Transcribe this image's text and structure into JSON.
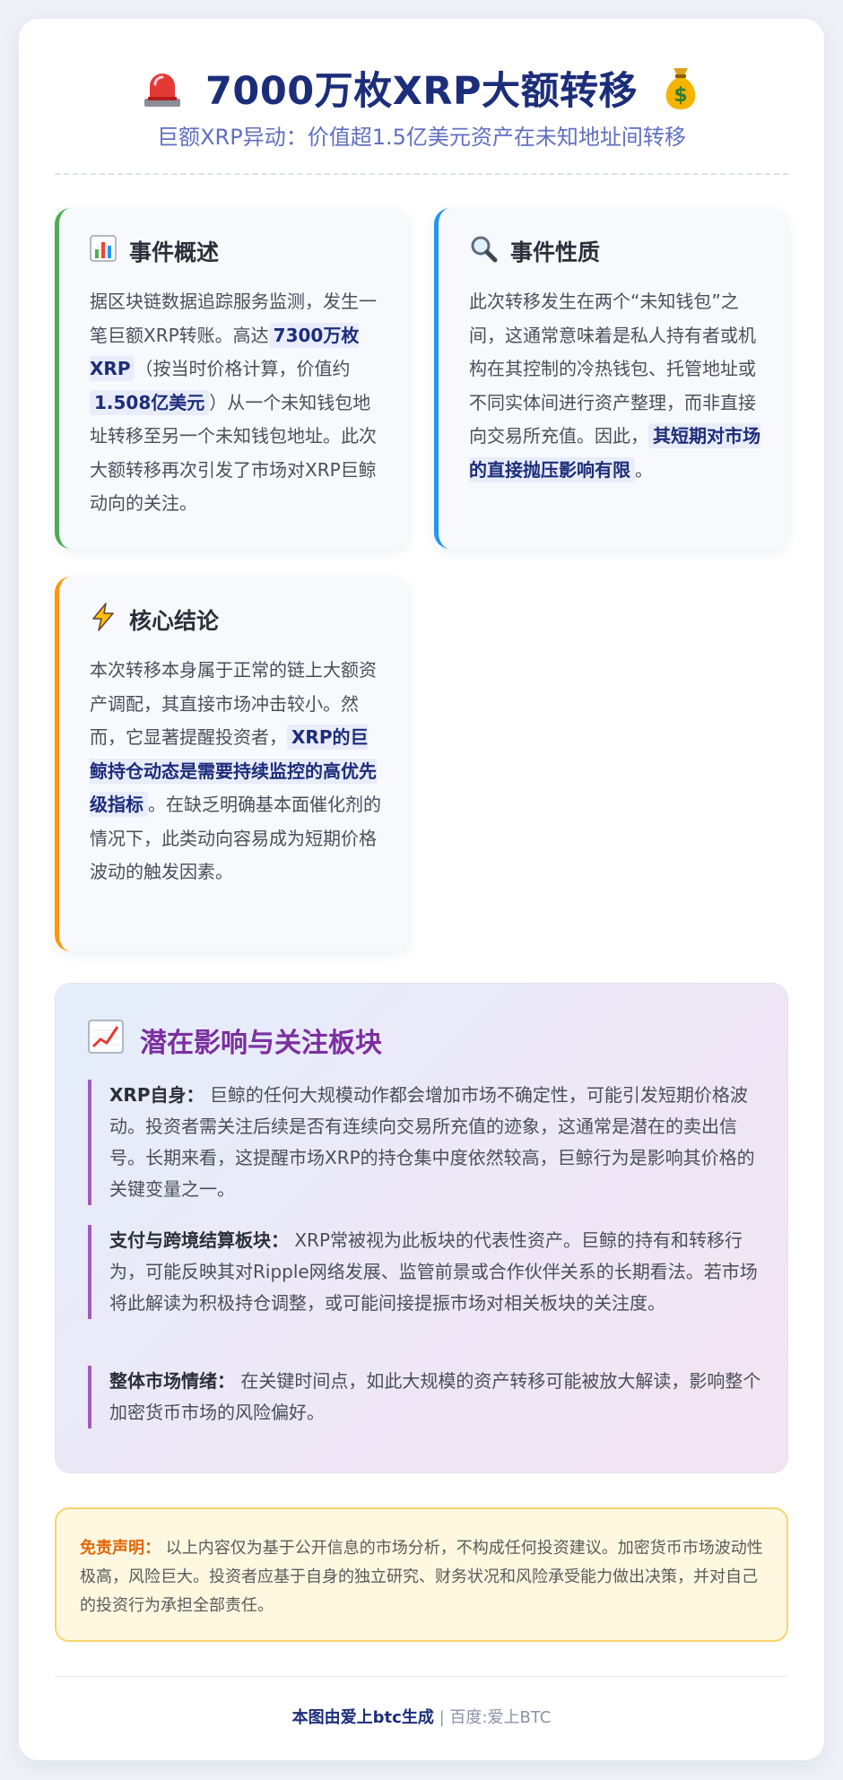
{
  "header": {
    "title": "7000万枚XRP大额转移",
    "subtitle": "巨额XRP异动：价值超1.5亿美元资产在未知地址间转移"
  },
  "overview": {
    "title": "事件概述",
    "p1": "据区块链数据追踪服务监测，发生一笔巨额XRP转账。高达",
    "hl1": "7300万枚XRP",
    "p2": "（按当时价格计算，价值约",
    "hl2": "1.508亿美元",
    "p3": "）从一个未知钱包地址转移至另一个未知钱包地址。此次大额转移再次引发了市场对XRP巨鲸动向的关注。"
  },
  "nature": {
    "title": "事件性质",
    "p1": "此次转移发生在两个“未知钱包”之间，这通常意味着是私人持有者或机构在其控制的冷热钱包、托管地址或不同实体间进行资产整理，而非直接向交易所充值。因此，",
    "hl1": "其短期对市场的直接抛压影响有限",
    "p2": "。"
  },
  "conclusion": {
    "title": "核心结论",
    "p1": "本次转移本身属于正常的链上大额资产调配，其直接市场冲击较小。然而，它显著提醒投资者，",
    "hl1": "XRP的巨鲸持仓动态是需要持续监控的高优先级指标",
    "p2": "。在缺乏明确基本面催化剂的情况下，此类动向容易成为短期价格波动的触发因素。"
  },
  "impact": {
    "title": "潜在影响与关注板块",
    "items": [
      {
        "label": "XRP自身：",
        "text": "巨鲸的任何大规模动作都会增加市场不确定性，可能引发短期价格波动。投资者需关注后续是否有连续向交易所充值的迹象，这通常是潜在的卖出信号。长期来看，这提醒市场XRP的持仓集中度依然较高，巨鲸行为是影响其价格的关键变量之一。"
      },
      {
        "label": "支付与跨境结算板块：",
        "text": "XRP常被视为此板块的代表性资产。巨鲸的持有和转移行为，可能反映其对Ripple网络发展、监管前景或合作伙伴关系的长期看法。若市场将此解读为积极持仓调整，或可能间接提振市场对相关板块的关注度。"
      },
      {
        "label": "整体市场情绪：",
        "text": "在关键时间点，如此大规模的资产转移可能被放大解读，影响整个加密货币市场的风险偏好。"
      }
    ]
  },
  "disclaimer": {
    "label": "免责声明：",
    "text": "以上内容仅为基于公开信息的市场分析，不构成任何投资建议。加密货币市场波动性极高，风险巨大。投资者应基于自身的独立研究、财务状况和风险承受能力做出决策，并对自己的投资行为承担全部责任。"
  },
  "footer": {
    "brand": "本图由爱上btc生成",
    "separator": "|",
    "source": "百度:爱上BTC"
  },
  "colors": {
    "title": "#1c2d7a",
    "overview_accent": "#4caf50",
    "nature_accent": "#2196f3",
    "conclusion_accent": "#ff9800",
    "impact_title": "#7b2fa0",
    "disclaimer_label": "#e0690a"
  },
  "icons": {
    "title_left": "siren-icon",
    "title_right": "money-bag-icon",
    "overview": "bar-chart-icon",
    "nature": "magnifier-icon",
    "conclusion": "lightning-icon",
    "impact": "trend-chart-icon"
  }
}
